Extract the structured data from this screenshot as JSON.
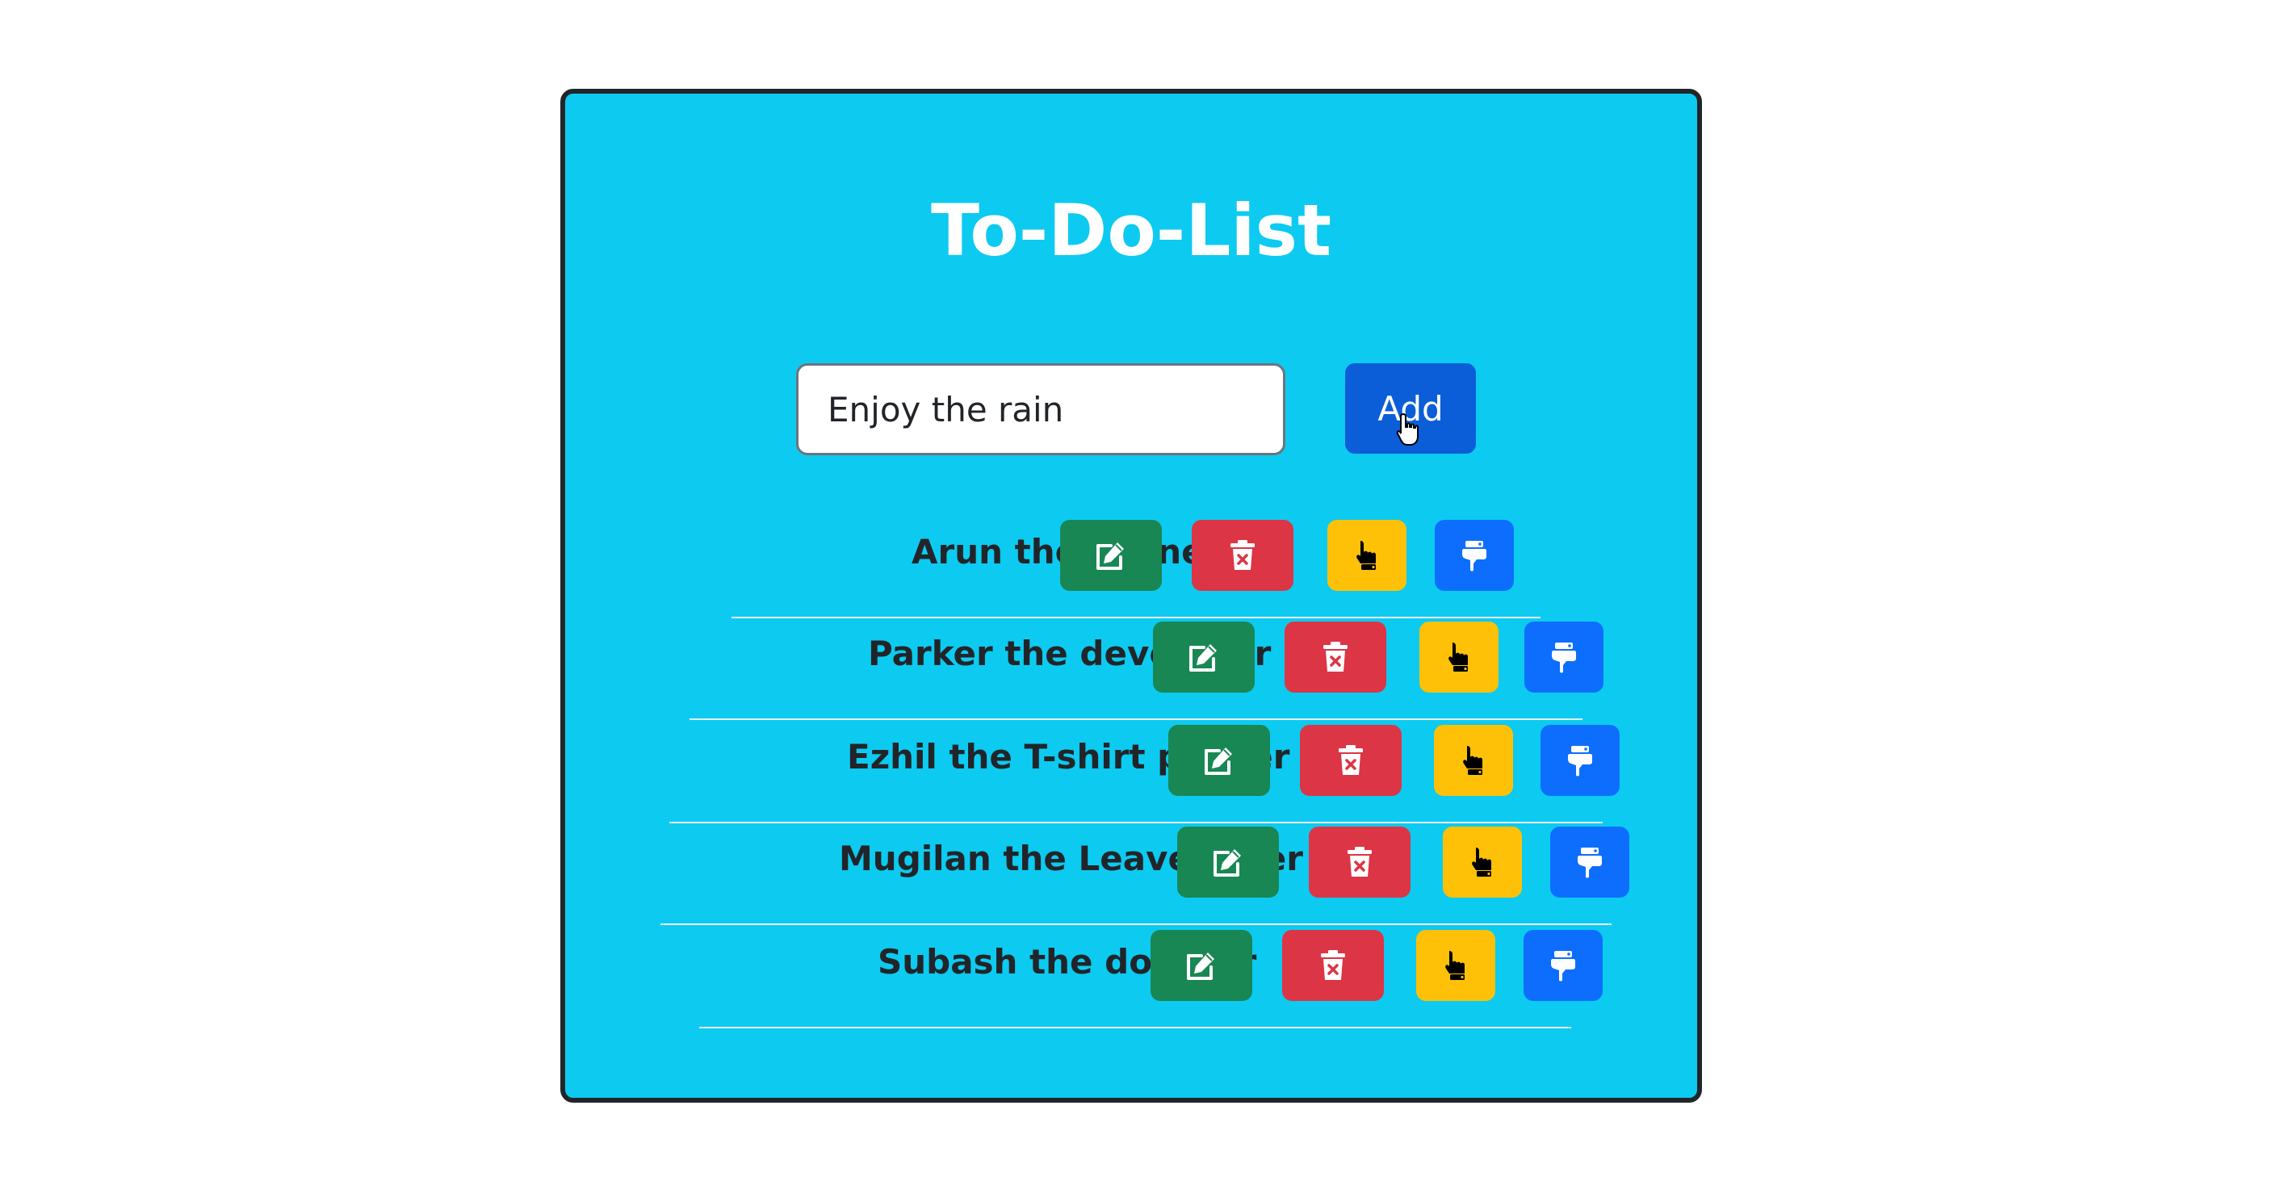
{
  "app": {
    "title": "To-Do-List"
  },
  "form": {
    "input_value": "Enjoy the rain",
    "add_label": "Add"
  },
  "tasks": [
    {
      "label": "Arun the trainer"
    },
    {
      "label": "Parker the developer"
    },
    {
      "label": "Ezhil the T-shirt printer"
    },
    {
      "label": "Mugilan the Leave taker"
    },
    {
      "label": "Subash the doubter"
    }
  ],
  "actions": {
    "edit_icon": "edit-icon",
    "delete_icon": "trash-icon",
    "like_icon": "hand-pointer-down-icon",
    "dislike_icon": "thumbtack-icon"
  },
  "colors": {
    "card_background": "#0dcaf0",
    "add_button": "#0b5ed7",
    "edit": "#198754",
    "delete": "#dc3545",
    "like": "#ffc107",
    "dislike": "#0d6efd"
  }
}
